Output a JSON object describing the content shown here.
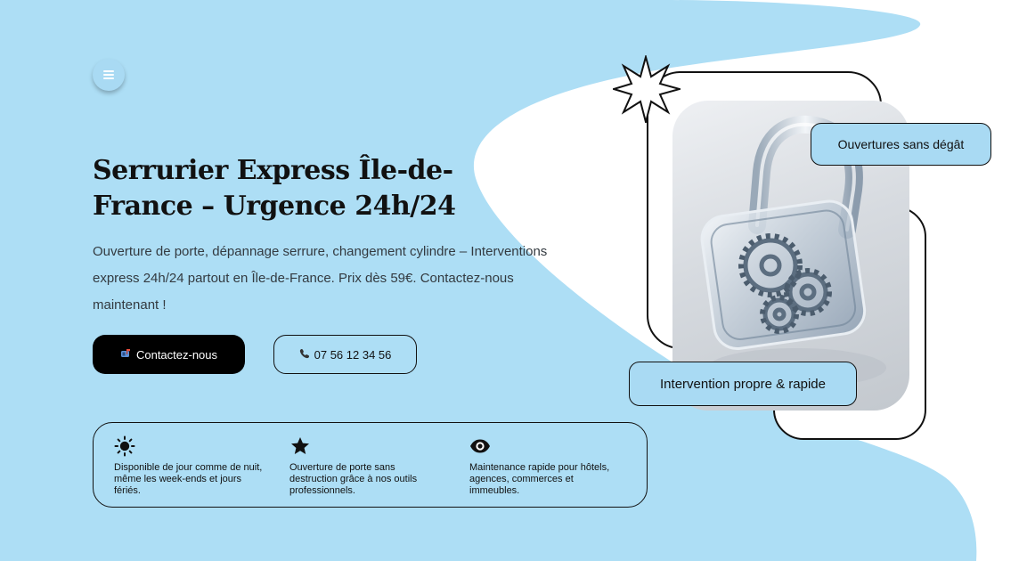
{
  "colors": {
    "accent": "#a9daf3",
    "primary_button": "#000000",
    "text": "#111111"
  },
  "nav": {
    "menu_icon": "hamburger-menu-icon"
  },
  "hero": {
    "title": "Serrurier Express Île-de-France – Urgence 24h/24",
    "description": "Ouverture de porte, dépannage serrure, changement cylindre – Interventions express 24h/24 partout en Île-de-France. Prix dès 59€. Contactez-nous maintenant !"
  },
  "buttons": {
    "contact": {
      "icon": "mailbox-icon",
      "label": "Contactez-nous"
    },
    "phone": {
      "icon": "phone-icon",
      "label": "07 56 12 34 56"
    }
  },
  "features": [
    {
      "icon": "sun-icon",
      "text": "Disponible de jour comme de nuit, même les week-ends et jours fériés."
    },
    {
      "icon": "star-icon",
      "text": "Ouverture de porte sans destruction grâce à nos outils professionnels."
    },
    {
      "icon": "eye-icon",
      "text": "Maintenance rapide pour hôtels, agences, commerces et immeubles."
    }
  ],
  "image": {
    "subject": "glass padlock with gears",
    "decor_icon": "sparkle-star-icon"
  },
  "badges": {
    "top": "Ouvertures sans dégât",
    "bottom": "Intervention propre & rapide"
  }
}
